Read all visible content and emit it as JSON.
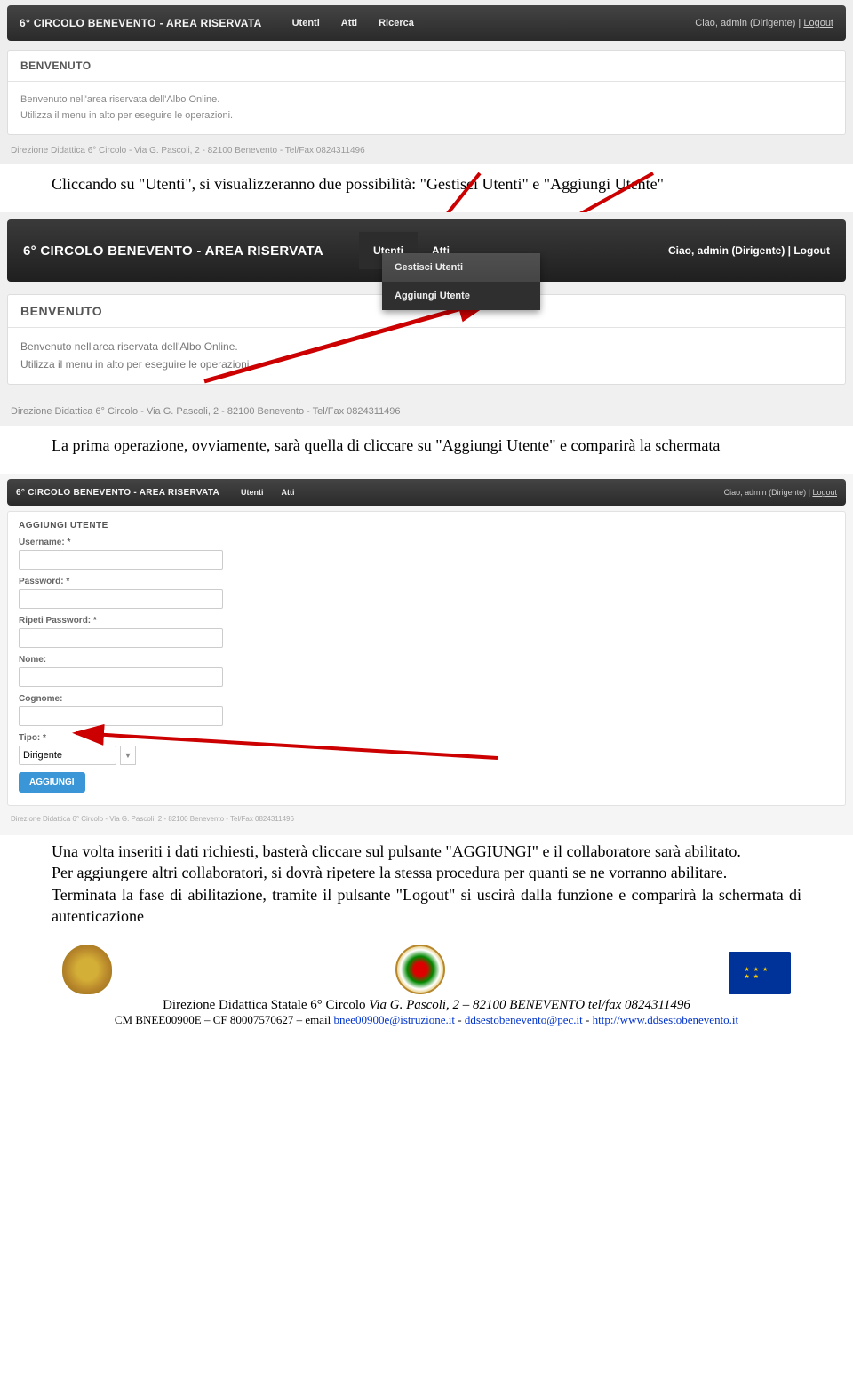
{
  "screenshot1": {
    "brand": "6° CIRCOLO BENEVENTO - AREA RISERVATA",
    "menu": [
      "Utenti",
      "Atti",
      "Ricerca"
    ],
    "userinfo_prefix": "Ciao, admin (Dirigente) | ",
    "logout": "Logout",
    "panel_title": "BENVENUTO",
    "welcome_line1": "Benvenuto nell'area riservata dell'Albo Online.",
    "welcome_line2": "Utilizza il menu in alto per eseguire le operazioni.",
    "footer": "Direzione Didattica 6° Circolo - Via G. Pascoli, 2 - 82100 Benevento - Tel/Fax 0824311496"
  },
  "doc_para1": "Cliccando su \"Utenti\", si visualizzeranno due possibilità: \"Gestisci Utenti\" e \"Aggiungi Utente\"",
  "screenshot2": {
    "brand": "6° CIRCOLO BENEVENTO - AREA RISERVATA",
    "menu": [
      "Utenti",
      "Atti"
    ],
    "userinfo_prefix": "Ciao, admin (Dirigente) | ",
    "logout": "Logout",
    "dropdown": [
      "Gestisci Utenti",
      "Aggiungi Utente"
    ],
    "panel_title": "BENVENUTO",
    "welcome_line1": "Benvenuto nell'area riservata dell'Albo Online.",
    "welcome_line2": "Utilizza il menu in alto per eseguire le operazioni.",
    "footer": "Direzione Didattica 6° Circolo - Via G. Pascoli, 2 - 82100 Benevento - Tel/Fax 0824311496"
  },
  "doc_para2": "La prima operazione, ovviamente, sarà quella di cliccare su \"Aggiungi Utente\" e comparirà la schermata",
  "screenshot3": {
    "brand": "6° CIRCOLO BENEVENTO - AREA RISERVATA",
    "menu": [
      "Utenti",
      "Atti"
    ],
    "userinfo_prefix": "Ciao, admin (Dirigente) | ",
    "logout": "Logout",
    "panel_title": "AGGIUNGI UTENTE",
    "fields": {
      "username": "Username: *",
      "password": "Password: *",
      "ripeti": "Ripeti Password: *",
      "nome": "Nome:",
      "cognome": "Cognome:",
      "tipo": "Tipo: *",
      "tipo_value": "Dirigente"
    },
    "submit": "AGGIUNGI",
    "footer": "Direzione Didattica 6° Circolo - Via G. Pascoli, 2 - 82100 Benevento - Tel/Fax 0824311496"
  },
  "doc_para3": "Una volta inseriti i dati richiesti, basterà cliccare sul pulsante \"AGGIUNGI\" e il collaboratore sarà abilitato.",
  "doc_para4": "Per aggiungere altri collaboratori, si dovrà ripetere la stessa procedura per quanti se ne vorranno abilitare.",
  "doc_para5": "Terminata la fase di abilitazione, tramite il pulsante \"Logout\" si uscirà dalla funzione e comparirà la schermata di autenticazione",
  "page_footer": {
    "line1_a": "Direzione Didattica Statale 6° Circolo ",
    "line1_b": "Via G. Pascoli, 2 – 82100 BENEVENTO   tel/fax 0824311496",
    "line2_a": "CM  BNEE00900E – CF 80007570627 – email ",
    "link1": "bnee00900e@istruzione.it",
    "sep1": " - ",
    "link2": "ddsestobenevento@pec.it",
    "sep2": " - ",
    "link3": "http://www.ddsestobenevento.it"
  }
}
